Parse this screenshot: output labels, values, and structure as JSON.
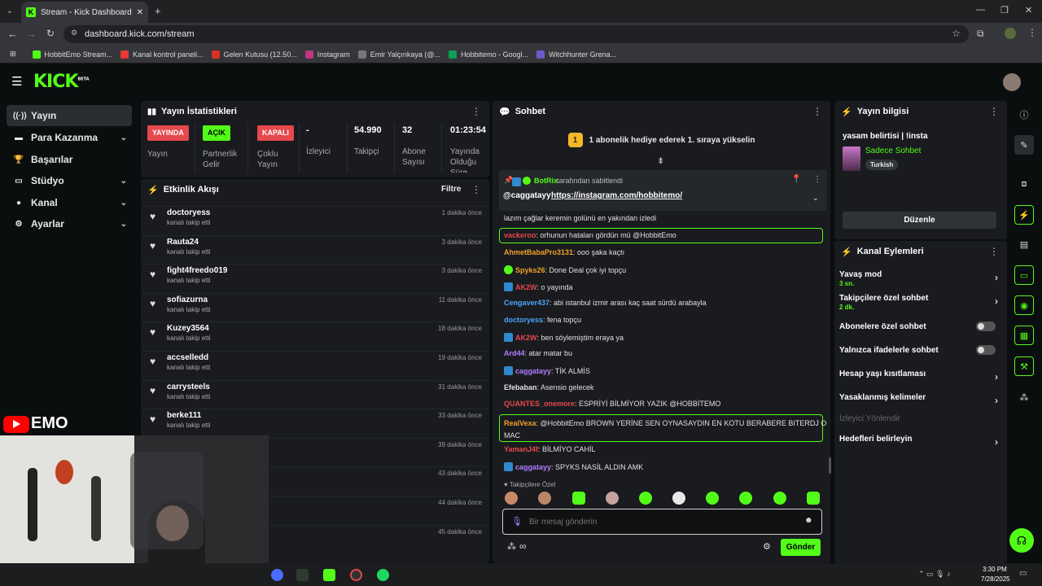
{
  "browser": {
    "tab_title": "Stream - Kick Dashboard",
    "url": "dashboard.kick.com/stream",
    "bookmarks": [
      "HobbitEmo Stream...",
      "Kanal kontrol paneli...",
      "Gelen Kutusu (12.50...",
      "Instagram",
      "Emir Yalçınkaya (@...",
      "Hobbitemo - Googl...",
      "Witchhunter Grena..."
    ]
  },
  "brand": {
    "logo": "KICK",
    "beta": "BETA",
    "accent": "#53fc18"
  },
  "sidebar": {
    "items": [
      {
        "label": "Yayın",
        "icon": "broadcast-icon"
      },
      {
        "label": "Para Kazanma",
        "icon": "wallet-icon"
      },
      {
        "label": "Başarılar",
        "icon": "trophy-icon"
      },
      {
        "label": "Stüdyo",
        "icon": "monitor-icon"
      },
      {
        "label": "Kanal",
        "icon": "user-icon"
      },
      {
        "label": "Ayarlar",
        "icon": "gear-icon"
      }
    ]
  },
  "stats": {
    "title": "Yayın İstatistikleri",
    "items": [
      {
        "badge": "YAYINDA",
        "label": "Yayın"
      },
      {
        "badge": "AÇIK",
        "label": "Partnerlik Gelir"
      },
      {
        "badge": "KAPALI",
        "label": "Çoklu Yayın"
      },
      {
        "value": "-",
        "label": "İzleyici"
      },
      {
        "value": "54.990",
        "label": "Takipçi"
      },
      {
        "value": "32",
        "label": "Abone Sayısı"
      },
      {
        "value": "01:23:54",
        "label": "Yayında Olduğu Süre"
      }
    ]
  },
  "activity": {
    "title": "Etkinlik Akışı",
    "filter": "Filtre",
    "items": [
      {
        "user": "doctoryess",
        "action": "kanalı takip etti",
        "time": "1 dakika önce"
      },
      {
        "user": "Rauta24",
        "action": "kanalı takip etti",
        "time": "3 dakika önce"
      },
      {
        "user": "fight4freedo019",
        "action": "kanalı takip etti",
        "time": "3 dakika önce"
      },
      {
        "user": "sofiazurna",
        "action": "kanalı takip etti",
        "time": "11 dakika önce"
      },
      {
        "user": "Kuzey3564",
        "action": "kanalı takip etti",
        "time": "18 dakika önce"
      },
      {
        "user": "accselledd",
        "action": "kanalı takip etti",
        "time": "19 dakika önce"
      },
      {
        "user": "carrysteels",
        "action": "kanalı takip etti",
        "time": "31 dakika önce"
      },
      {
        "user": "berke111",
        "action": "kanalı takip etti",
        "time": "33 dakika önce"
      },
      {
        "user": "",
        "action": "",
        "time": "39 dakika önce"
      },
      {
        "user": "",
        "action": "",
        "time": "43 dakika önce"
      },
      {
        "user": "",
        "action": "",
        "time": "44 dakika önce"
      },
      {
        "user": "",
        "action": "",
        "time": "45 dakika önce"
      }
    ]
  },
  "webcam": {
    "overlay_label": "EMO"
  },
  "chat": {
    "title": "Sohbet",
    "banner_rank": "1",
    "banner_text": "1 abonelik hediye ederek 1. sıraya yükselin",
    "pinned": {
      "bot": "BotRix",
      "by": "tarafından sabitlendi",
      "mention": "@caggatayy",
      "link": "https://instagram.com/hobbitemo/"
    },
    "messages": [
      {
        "user": "",
        "color": "#e0e0e0",
        "text": "lazım çağlar keremin golünü en yakından izledi"
      },
      {
        "user": "vackeroo",
        "color": "#e5484d",
        "text": ": orhunun hataları gördün mü @HobbitEmo",
        "hl": true
      },
      {
        "user": "AhmetBabaPro3131",
        "color": "#f0a02a",
        "text": ": ooo şaka kaçtı"
      },
      {
        "user": "Spyks26",
        "color": "#f0a02a",
        "text": ": Done Deal çok iyi topçu",
        "badge": "verified"
      },
      {
        "user": "AK2W",
        "color": "#e5484d",
        "text": ": o yayında",
        "badge": "sub"
      },
      {
        "user": "Cengaver437",
        "color": "#4ea5ff",
        "text": ": abi istanbul izmir arası kaç saat sürdü arabayla"
      },
      {
        "user": "doctoryess",
        "color": "#4ea5ff",
        "text": ": fena topçu"
      },
      {
        "user": "AK2W",
        "color": "#e5484d",
        "text": ": ben söylemiştim eraya ya",
        "badge": "sub"
      },
      {
        "user": "Ard44",
        "color": "#b47cff",
        "text": ": atar matar bu"
      },
      {
        "user": "caggatayy",
        "color": "#b47cff",
        "text": ": TİK ALMİS",
        "badge": "sub"
      },
      {
        "user": "Efebaban",
        "color": "#e0e0e0",
        "text": ": Asensio gelecek"
      },
      {
        "user": "QUANTES_onemore",
        "color": "#e5484d",
        "text": ": ESPRİYİ BİLMİYOR YAZIK @HOBBİTEMO"
      },
      {
        "user": "RealVexa",
        "color": "#f0a02a",
        "text": ": @HobbitEmo BROWN YERİNE SEN OYNASAYDIN EN KOTU BERABERE BITERDJ O",
        "text2": "MAC",
        "hl": true
      },
      {
        "user": "YamanJ4f",
        "color": "#e5484d",
        "text": ": BİLMİYO CAHİL"
      },
      {
        "user": "caggatayy",
        "color": "#b47cff",
        "text": ": SPYKS NASİL ALDIN AMK",
        "badge": "sub"
      }
    ],
    "followers_only": "Takipçilere Özel",
    "input_placeholder": "Bir mesaj gönderin",
    "send": "Gönder"
  },
  "stream_info": {
    "title": "Yayın bilgisi",
    "stream_title": "yasam belirtisi | !insta",
    "category": "Sadece Sohbet",
    "tag": "Turkish",
    "edit": "Düzenle"
  },
  "channel_actions": {
    "title": "Kanal Eylemleri",
    "rows": [
      {
        "label": "Yavaş mod",
        "sub": "3 sn.",
        "type": "arrow"
      },
      {
        "label": "Takipçilere özel sohbet",
        "sub": "2 dk.",
        "type": "arrow"
      },
      {
        "label": "Abonelere özel sohbet",
        "type": "toggle"
      },
      {
        "label": "Yalnızca ifadelerle sohbet",
        "type": "toggle"
      },
      {
        "label": "Hesap yaşı kısıtlaması",
        "type": "arrow"
      },
      {
        "label": "Yasaklanmış kelimeler",
        "type": "arrow"
      },
      {
        "label": "İzleyici Yönlendir",
        "type": "disabled"
      },
      {
        "label": "Hedefleri belirleyin",
        "type": "arrow"
      }
    ]
  },
  "taskbar": {
    "time": "3:30 PM",
    "date": "7/28/2025"
  }
}
